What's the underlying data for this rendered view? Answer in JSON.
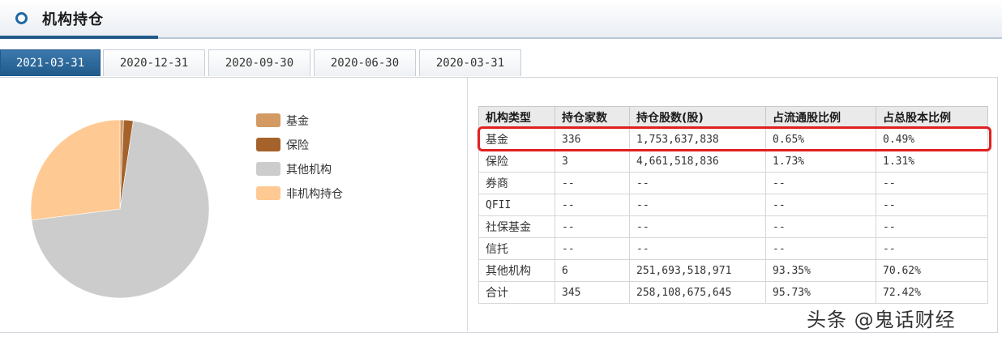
{
  "header": {
    "title": "机构持仓"
  },
  "tabs": [
    {
      "label": "2021-03-31",
      "active": true
    },
    {
      "label": "2020-12-31",
      "active": false
    },
    {
      "label": "2020-09-30",
      "active": false
    },
    {
      "label": "2020-06-30",
      "active": false
    },
    {
      "label": "2020-03-31",
      "active": false
    }
  ],
  "chart_data": {
    "type": "pie",
    "series": [
      {
        "label": "基金",
        "value": 0.65,
        "color": "#d39a63"
      },
      {
        "label": "保险",
        "value": 1.73,
        "color": "#a5622b"
      },
      {
        "label": "其他机构",
        "value": 70.62,
        "color": "#cccccc"
      },
      {
        "label": "非机构持仓",
        "value": 27.0,
        "color": "#ffc993"
      }
    ],
    "legend_position": "right"
  },
  "legend": [
    {
      "label": "基金",
      "color": "#d39a63"
    },
    {
      "label": "保险",
      "color": "#a5622b"
    },
    {
      "label": "其他机构",
      "color": "#cccccc"
    },
    {
      "label": "非机构持仓",
      "color": "#ffc993"
    }
  ],
  "table": {
    "headers": [
      "机构类型",
      "持仓家数",
      "持仓股数(股)",
      "占流通股比例",
      "占总股本比例"
    ],
    "rows": [
      [
        "基金",
        "336",
        "1,753,637,838",
        "0.65%",
        "0.49%"
      ],
      [
        "保险",
        "3",
        "4,661,518,836",
        "1.73%",
        "1.31%"
      ],
      [
        "券商",
        "--",
        "--",
        "--",
        "--"
      ],
      [
        "QFII",
        "--",
        "--",
        "--",
        "--"
      ],
      [
        "社保基金",
        "--",
        "--",
        "--",
        "--"
      ],
      [
        "信托",
        "--",
        "--",
        "--",
        "--"
      ],
      [
        "其他机构",
        "6",
        "251,693,518,971",
        "93.35%",
        "70.62%"
      ],
      [
        "合计",
        "345",
        "258,108,675,645",
        "95.73%",
        "72.42%"
      ]
    ]
  },
  "watermark": "头条 @鬼话财经",
  "highlight_color": "#e02020"
}
